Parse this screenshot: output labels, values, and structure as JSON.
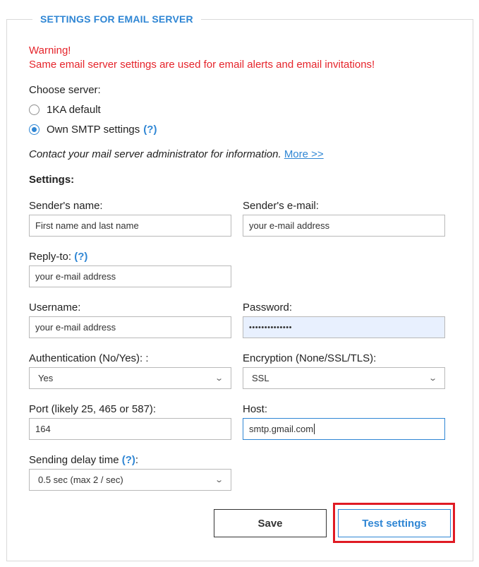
{
  "section": {
    "title": "SETTINGS FOR EMAIL SERVER"
  },
  "warning": {
    "line1": "Warning!",
    "line2": "Same email server settings are used for email alerts and email invitations!"
  },
  "server": {
    "label": "Choose server:",
    "options": [
      {
        "label": "1KA default",
        "selected": false
      },
      {
        "label": "Own SMTP settings",
        "selected": true,
        "help": "(?)"
      }
    ]
  },
  "info": {
    "text": "Contact your mail server administrator for information.",
    "link": "More >>"
  },
  "settings": {
    "heading": "Settings:",
    "sender_name": {
      "label": "Sender's name:",
      "value": "First name and last name"
    },
    "sender_email": {
      "label": "Sender's e-mail:",
      "value": "your e-mail address"
    },
    "reply_to": {
      "label": "Reply-to:",
      "help": "(?)",
      "value": "your e-mail address"
    },
    "username": {
      "label": "Username:",
      "value": "your e-mail address"
    },
    "password": {
      "label": "Password:",
      "value": "••••••••••••••"
    },
    "authentication": {
      "label": "Authentication (No/Yes): :",
      "value": "Yes"
    },
    "encryption": {
      "label": "Encryption (None/SSL/TLS):",
      "value": "SSL"
    },
    "port": {
      "label": "Port (likely 25, 465 or 587):",
      "value": "164"
    },
    "host": {
      "label": "Host:",
      "value": "smtp.gmail.com"
    },
    "delay": {
      "label": "Sending delay time",
      "help": "(?)",
      "suffix": ":",
      "value": "0.5 sec (max 2 / sec)"
    }
  },
  "buttons": {
    "save": "Save",
    "test": "Test settings"
  },
  "colors": {
    "accent": "#2f86d4",
    "warning": "#e5242b",
    "highlight": "#e01b24"
  }
}
